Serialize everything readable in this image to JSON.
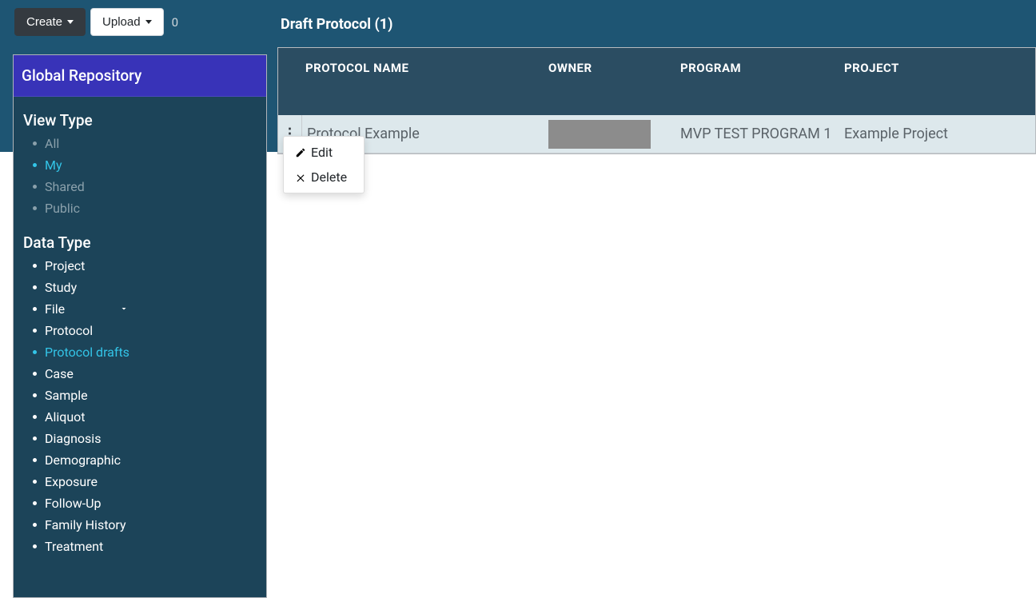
{
  "toolbar": {
    "create_label": "Create",
    "upload_label": "Upload",
    "count": "0"
  },
  "sidebar": {
    "header": "Global Repository",
    "view_type_title": "View Type",
    "view_types": [
      {
        "label": "All",
        "muted": true
      },
      {
        "label": "My",
        "active": true
      },
      {
        "label": "Shared",
        "muted": true
      },
      {
        "label": "Public",
        "muted": true
      }
    ],
    "data_type_title": "Data Type",
    "data_types": [
      {
        "label": "Project"
      },
      {
        "label": "Study"
      },
      {
        "label": "File",
        "chevron": true
      },
      {
        "label": "Protocol"
      },
      {
        "label": "Protocol drafts",
        "active": true
      },
      {
        "label": "Case"
      },
      {
        "label": "Sample"
      },
      {
        "label": "Aliquot"
      },
      {
        "label": "Diagnosis"
      },
      {
        "label": "Demographic"
      },
      {
        "label": "Exposure"
      },
      {
        "label": "Follow-Up"
      },
      {
        "label": "Family History"
      },
      {
        "label": "Treatment"
      }
    ]
  },
  "main": {
    "title": "Draft Protocol (1)",
    "columns": {
      "name": "PROTOCOL NAME",
      "owner": "OWNER",
      "program": "PROGRAM",
      "project": "PROJECT"
    },
    "row": {
      "name": "Protocol Example",
      "owner": "",
      "program": "MVP TEST PROGRAM 1",
      "project": "Example Project"
    }
  },
  "context_menu": {
    "edit": "Edit",
    "delete": "Delete"
  }
}
